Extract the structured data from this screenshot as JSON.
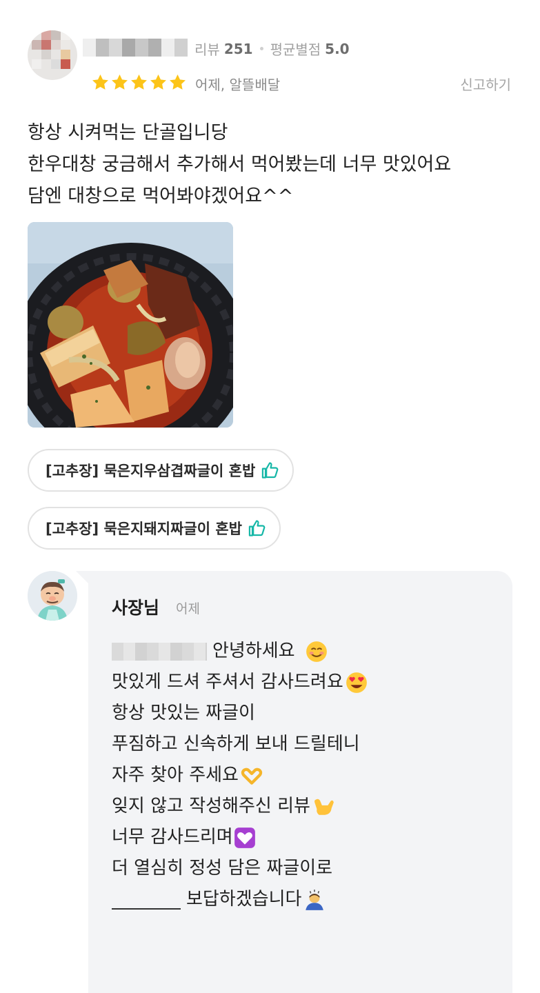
{
  "header": {
    "review_count_label": "리뷰",
    "review_count": "251",
    "avg_rating_label": "평균별점",
    "avg_rating": "5.0",
    "stars": 5,
    "date_and_type": "어제, 알뜰배달",
    "report_label": "신고하기"
  },
  "review": {
    "lines": [
      "항상 시켜먹는 단골입니당",
      "한우대창 궁금해서 추가해서 먹어봤는데 너무 맛있어요",
      "담엔 대창으로 먹어봐야겠어요^^"
    ]
  },
  "menus": [
    "[고추장] 묵은지우삼겹짜글이 혼밥",
    "[고추장] 묵은지돼지짜글이 혼밥"
  ],
  "reply": {
    "owner_name": "사장님",
    "date": "어제",
    "lines": [
      "안녕하세요",
      "맛있게 드셔 주셔서 감사드려요",
      "항상 맛있는 짜글이",
      "푸짐하고 신속하게 보내 드릴테니",
      "자주 찾아 주세요",
      "잊지 않고 작성해주신 리뷰",
      "너무 감사드리며",
      "더 열심히 정성 담은 짜글이로",
      "보답하겠습니다"
    ]
  },
  "colors": {
    "star": "#fcc419",
    "accent": "#16b7a7",
    "reply_bg": "#f3f4f6"
  }
}
